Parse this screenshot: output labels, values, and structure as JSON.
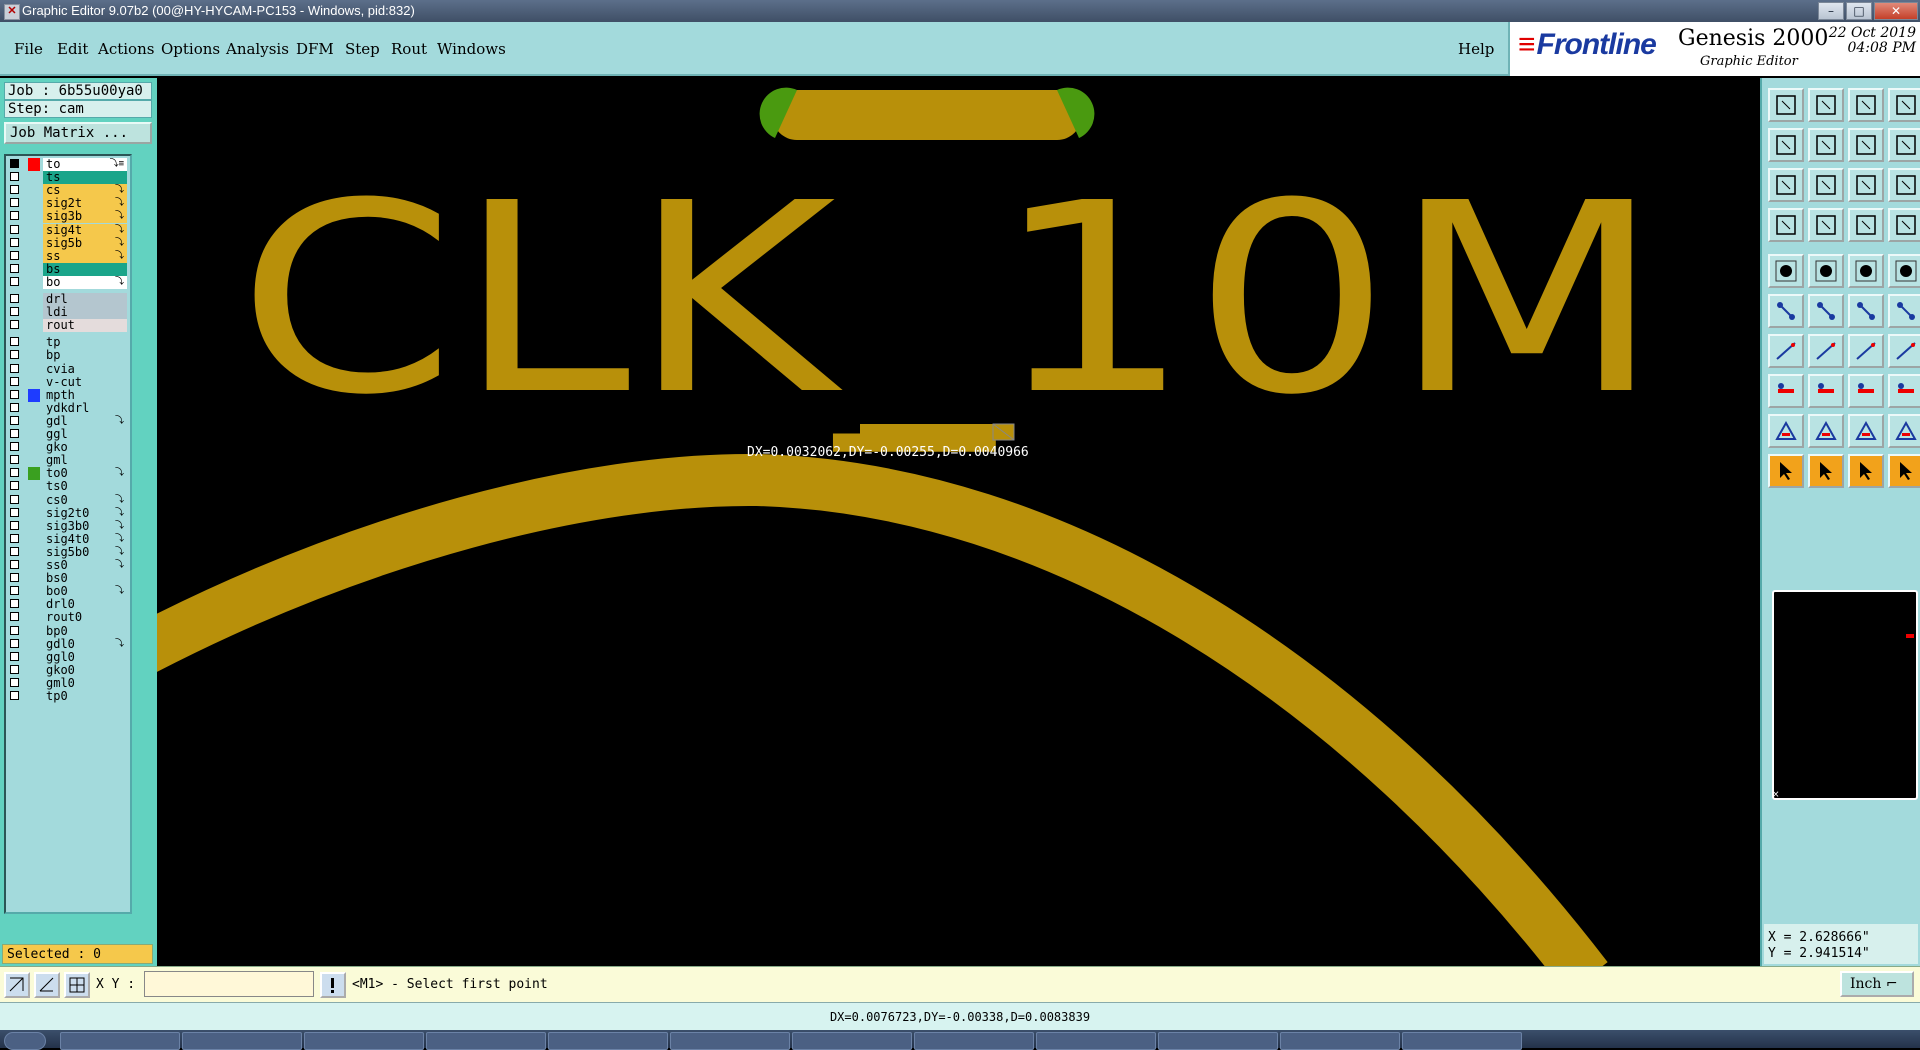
{
  "window": {
    "title": "Graphic Editor 9.07b2 (00@HY-HYCAM-PC153 - Windows, pid:832)",
    "controls": [
      "–",
      "□",
      "✕"
    ]
  },
  "menubar": {
    "items": [
      "File",
      "Edit",
      "Actions",
      "Options",
      "Analysis",
      "DFM",
      "Step",
      "Rout",
      "Windows"
    ],
    "help": "Help"
  },
  "brand": {
    "logo": "Frontline",
    "product": "Genesis 2000",
    "subtitle": "Graphic Editor",
    "date": "22 Oct 2019",
    "time": "04:08 PM"
  },
  "left": {
    "job": "Job : 6b55u00ya0",
    "step": "Step: cam",
    "job_matrix": "Job Matrix ...",
    "selected": "Selected : 0",
    "layers": [
      {
        "name": "to",
        "bg": "#ffffff",
        "color": "#ff0000",
        "mark": "⤵≡",
        "checked": true
      },
      {
        "name": "ts",
        "bg": "#1aa58a",
        "color": "",
        "mark": ""
      },
      {
        "name": "cs",
        "bg": "#f5c84b",
        "color": "",
        "mark": "⤵"
      },
      {
        "name": "sig2t",
        "bg": "#f5c84b",
        "color": "",
        "mark": "⤵"
      },
      {
        "name": "sig3b",
        "bg": "#f5c84b",
        "color": "",
        "mark": "⤵"
      },
      {
        "name": "sig4t",
        "bg": "#f5c84b",
        "color": "",
        "mark": "⤵"
      },
      {
        "name": "sig5b",
        "bg": "#f5c84b",
        "color": "",
        "mark": "⤵"
      },
      {
        "name": "ss",
        "bg": "#f5c84b",
        "color": "",
        "mark": "⤵"
      },
      {
        "name": "bs",
        "bg": "#1aa58a",
        "color": "",
        "mark": ""
      },
      {
        "name": "bo",
        "bg": "#ffffff",
        "color": "",
        "mark": "⤵"
      },
      {
        "name": "drl",
        "bg": "#b4c6cf",
        "color": "",
        "mark": "",
        "gap": true
      },
      {
        "name": "ldi",
        "bg": "#b4c6cf",
        "color": "",
        "mark": ""
      },
      {
        "name": "rout",
        "bg": "#e4dcdc",
        "color": "",
        "mark": ""
      },
      {
        "name": "tp",
        "bg": "#a3dadc",
        "color": "",
        "mark": "",
        "gap": true
      },
      {
        "name": "bp",
        "bg": "#a3dadc",
        "color": "",
        "mark": ""
      },
      {
        "name": "cvia",
        "bg": "#a3dadc",
        "color": "",
        "mark": ""
      },
      {
        "name": "v-cut",
        "bg": "#a3dadc",
        "color": "",
        "mark": ""
      },
      {
        "name": "mpth",
        "bg": "#a3dadc",
        "color": "#1e3cff",
        "mark": ""
      },
      {
        "name": "ydkdrl",
        "bg": "#a3dadc",
        "color": "",
        "mark": ""
      },
      {
        "name": "gdl",
        "bg": "#a3dadc",
        "color": "",
        "mark": "⤵"
      },
      {
        "name": "ggl",
        "bg": "#a3dadc",
        "color": "",
        "mark": ""
      },
      {
        "name": "gko",
        "bg": "#a3dadc",
        "color": "",
        "mark": ""
      },
      {
        "name": "gml",
        "bg": "#a3dadc",
        "color": "",
        "mark": ""
      },
      {
        "name": "to0",
        "bg": "#a3dadc",
        "color": "#3aa020",
        "mark": "⤵"
      },
      {
        "name": "ts0",
        "bg": "#a3dadc",
        "color": "",
        "mark": ""
      },
      {
        "name": "cs0",
        "bg": "#a3dadc",
        "color": "",
        "mark": "⤵"
      },
      {
        "name": "sig2t0",
        "bg": "#a3dadc",
        "color": "",
        "mark": "⤵"
      },
      {
        "name": "sig3b0",
        "bg": "#a3dadc",
        "color": "",
        "mark": "⤵"
      },
      {
        "name": "sig4t0",
        "bg": "#a3dadc",
        "color": "",
        "mark": "⤵"
      },
      {
        "name": "sig5b0",
        "bg": "#a3dadc",
        "color": "",
        "mark": "⤵"
      },
      {
        "name": "ss0",
        "bg": "#a3dadc",
        "color": "",
        "mark": "⤵"
      },
      {
        "name": "bs0",
        "bg": "#a3dadc",
        "color": "",
        "mark": ""
      },
      {
        "name": "bo0",
        "bg": "#a3dadc",
        "color": "",
        "mark": "⤵"
      },
      {
        "name": "drl0",
        "bg": "#a3dadc",
        "color": "",
        "mark": ""
      },
      {
        "name": "rout0",
        "bg": "#a3dadc",
        "color": "",
        "mark": ""
      },
      {
        "name": "bp0",
        "bg": "#a3dadc",
        "color": "",
        "mark": ""
      },
      {
        "name": "gdl0",
        "bg": "#a3dadc",
        "color": "",
        "mark": "⤵"
      },
      {
        "name": "ggl0",
        "bg": "#a3dadc",
        "color": "",
        "mark": ""
      },
      {
        "name": "gko0",
        "bg": "#a3dadc",
        "color": "",
        "mark": ""
      },
      {
        "name": "gml0",
        "bg": "#a3dadc",
        "color": "",
        "mark": ""
      },
      {
        "name": "tp0",
        "bg": "#a3dadc",
        "color": "",
        "mark": ""
      }
    ]
  },
  "canvas": {
    "text": "CLK_10M",
    "measure_label": "DX=0.0032062,DY=-0.00255,D=0.0040966",
    "feature_color": "#b8900a",
    "highlight_color": "#4a9a10"
  },
  "right": {
    "x": "X = 2.628666\"",
    "y": "Y = 2.941514\"",
    "tool_icons": [
      "zoom-home-icon",
      "zoom-in-icon",
      "home-icon",
      "window-icon",
      "pan-left-icon",
      "pan-right-icon",
      "undo-view-icon",
      "redraw-icon",
      "fit-icon",
      "center-icon",
      "scale-icon",
      "help-icon",
      "snap-icon",
      "measure-icon",
      "layer-icon",
      "layers-icon",
      "pad-icon",
      "shape-icon",
      "line-icon",
      "circle-icon",
      "node-icon",
      "cross-icon",
      "point-icon",
      "point2-icon",
      "line-tool-icon",
      "line2-icon",
      "arc-icon",
      "flip-icon",
      "move-icon",
      "minus-icon",
      "dim-icon",
      "pattern-icon",
      "triangle-icon",
      "triangle2-icon",
      "triangle3-icon",
      "triangle4-icon",
      "pointer-icon",
      "pointer2-icon",
      "pointer3-icon",
      "pointer4-icon"
    ]
  },
  "bottom": {
    "xy_label": "X Y :",
    "xy_value": "",
    "prompt": "<M1> - Select first point",
    "unit": "Inch",
    "measure": "DX=0.0076723,DY=-0.00338,D=0.0083839"
  }
}
